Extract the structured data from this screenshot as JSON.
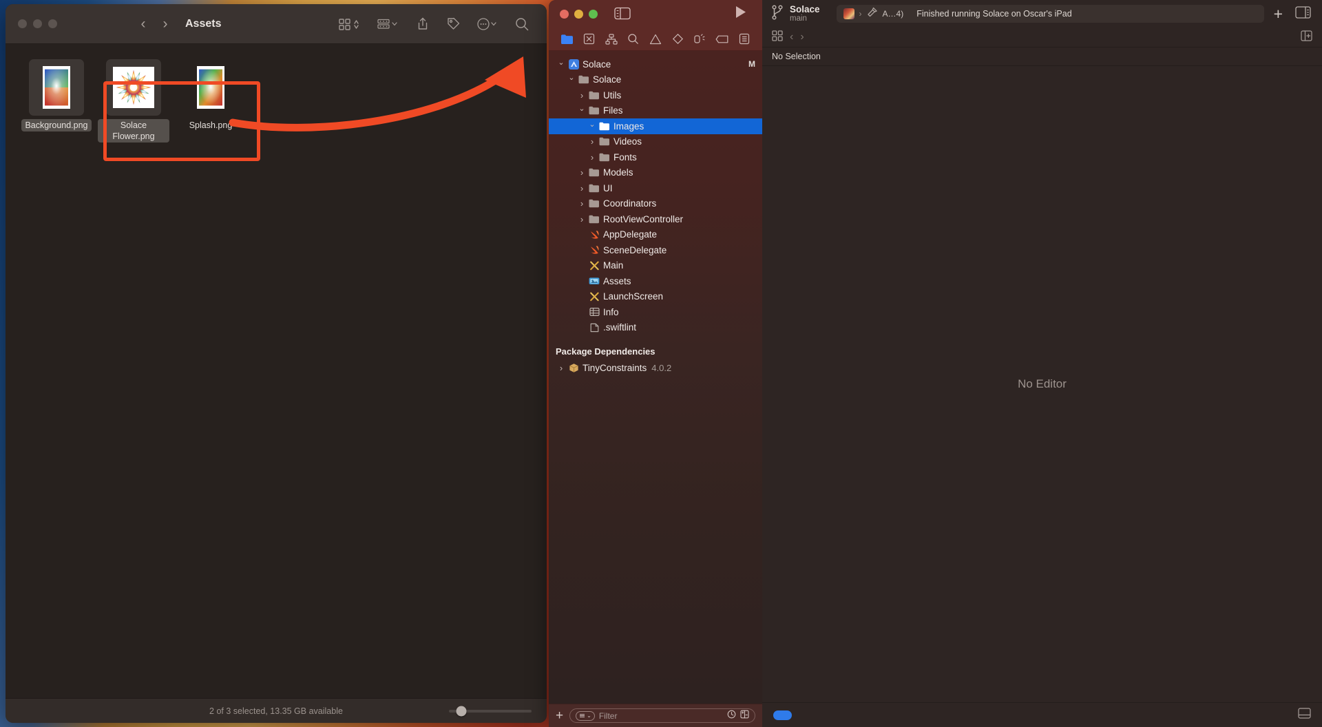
{
  "finder": {
    "title": "Assets",
    "traffic_lights": [
      "close",
      "minimize",
      "zoom"
    ],
    "toolbar_icons": [
      "back-chevron",
      "forward-chevron",
      "icon-view",
      "group-by",
      "share",
      "tag",
      "more-actions",
      "search"
    ],
    "files": [
      {
        "name": "Background.png",
        "selected": true,
        "thumb": "portrait-gradient"
      },
      {
        "name": "Solace Flower.png",
        "selected": true,
        "thumb": "flower-starburst"
      },
      {
        "name": "Splash.png",
        "selected": false,
        "thumb": "portrait-splash"
      }
    ],
    "status": "2 of 3 selected, 13.35 GB available",
    "zoom_slider_value": 18
  },
  "xcode": {
    "traffic_lights": [
      "close",
      "minimize",
      "zoom"
    ],
    "sidebar_toggle": "sidebar-toggle-icon",
    "run_button": "run-icon",
    "scheme": {
      "name": "Solace",
      "branch": "main"
    },
    "activity": {
      "app_icon": "solace-app-icon",
      "separator": "›",
      "build_icon": "hammer-icon",
      "destination": "A…4)",
      "message": "Finished running Solace on Oscar's iPad"
    },
    "add_button": "+",
    "inspector_toggle": "inspector-toggle-icon",
    "navigator": {
      "tabs": [
        {
          "name": "project-navigator",
          "active": true
        },
        {
          "name": "source-control-navigator",
          "active": false
        },
        {
          "name": "hierarchy-navigator",
          "active": false
        },
        {
          "name": "find-navigator",
          "active": false
        },
        {
          "name": "issue-navigator",
          "active": false
        },
        {
          "name": "test-navigator",
          "active": false
        },
        {
          "name": "debug-navigator",
          "active": false
        },
        {
          "name": "breakpoint-navigator",
          "active": false
        },
        {
          "name": "report-navigator",
          "active": false
        }
      ],
      "tree": [
        {
          "label": "Solace",
          "indent": 0,
          "disc": "open",
          "icon": "xcode-project",
          "badge": "M"
        },
        {
          "label": "Solace",
          "indent": 1,
          "disc": "open",
          "icon": "folder"
        },
        {
          "label": "Utils",
          "indent": 2,
          "disc": "closed",
          "icon": "folder"
        },
        {
          "label": "Files",
          "indent": 2,
          "disc": "open",
          "icon": "folder"
        },
        {
          "label": "Images",
          "indent": 3,
          "disc": "open",
          "icon": "folder-open-white",
          "selected": true
        },
        {
          "label": "Videos",
          "indent": 3,
          "disc": "closed",
          "icon": "folder"
        },
        {
          "label": "Fonts",
          "indent": 3,
          "disc": "closed",
          "icon": "folder"
        },
        {
          "label": "Models",
          "indent": 2,
          "disc": "closed",
          "icon": "folder"
        },
        {
          "label": "UI",
          "indent": 2,
          "disc": "closed",
          "icon": "folder"
        },
        {
          "label": "Coordinators",
          "indent": 2,
          "disc": "closed",
          "icon": "folder"
        },
        {
          "label": "RootViewController",
          "indent": 2,
          "disc": "closed",
          "icon": "folder"
        },
        {
          "label": "AppDelegate",
          "indent": 2,
          "disc": "none",
          "icon": "swift"
        },
        {
          "label": "SceneDelegate",
          "indent": 2,
          "disc": "none",
          "icon": "swift"
        },
        {
          "label": "Main",
          "indent": 2,
          "disc": "none",
          "icon": "storyboard"
        },
        {
          "label": "Assets",
          "indent": 2,
          "disc": "none",
          "icon": "assets"
        },
        {
          "label": "LaunchScreen",
          "indent": 2,
          "disc": "none",
          "icon": "storyboard"
        },
        {
          "label": "Info",
          "indent": 2,
          "disc": "none",
          "icon": "plist"
        },
        {
          "label": ".swiftlint",
          "indent": 2,
          "disc": "none",
          "icon": "textfile"
        }
      ],
      "section_header": "Package Dependencies",
      "packages": [
        {
          "label": "TinyConstraints",
          "version": "4.0.2",
          "disc": "closed",
          "icon": "package"
        }
      ],
      "filter": {
        "add_label": "+",
        "placeholder": "Filter",
        "recent_icon": "clock-icon",
        "sourcecontrol_icon": "diff-icon"
      }
    },
    "editor": {
      "jumpbar_icons": [
        "related-items-icon",
        "back-chevron",
        "forward-chevron"
      ],
      "add_editor_icon": "add-editor-icon",
      "breadcrumb": "No Selection",
      "empty_message": "No Editor",
      "status_pill": "activity-pill",
      "debug_toggle": "debug-area-toggle-icon"
    }
  },
  "annotations": {
    "selection_rect_color": "#f04a25",
    "arrow_color": "#f04a25",
    "arrow_description": "drag from selected files to Images folder"
  }
}
